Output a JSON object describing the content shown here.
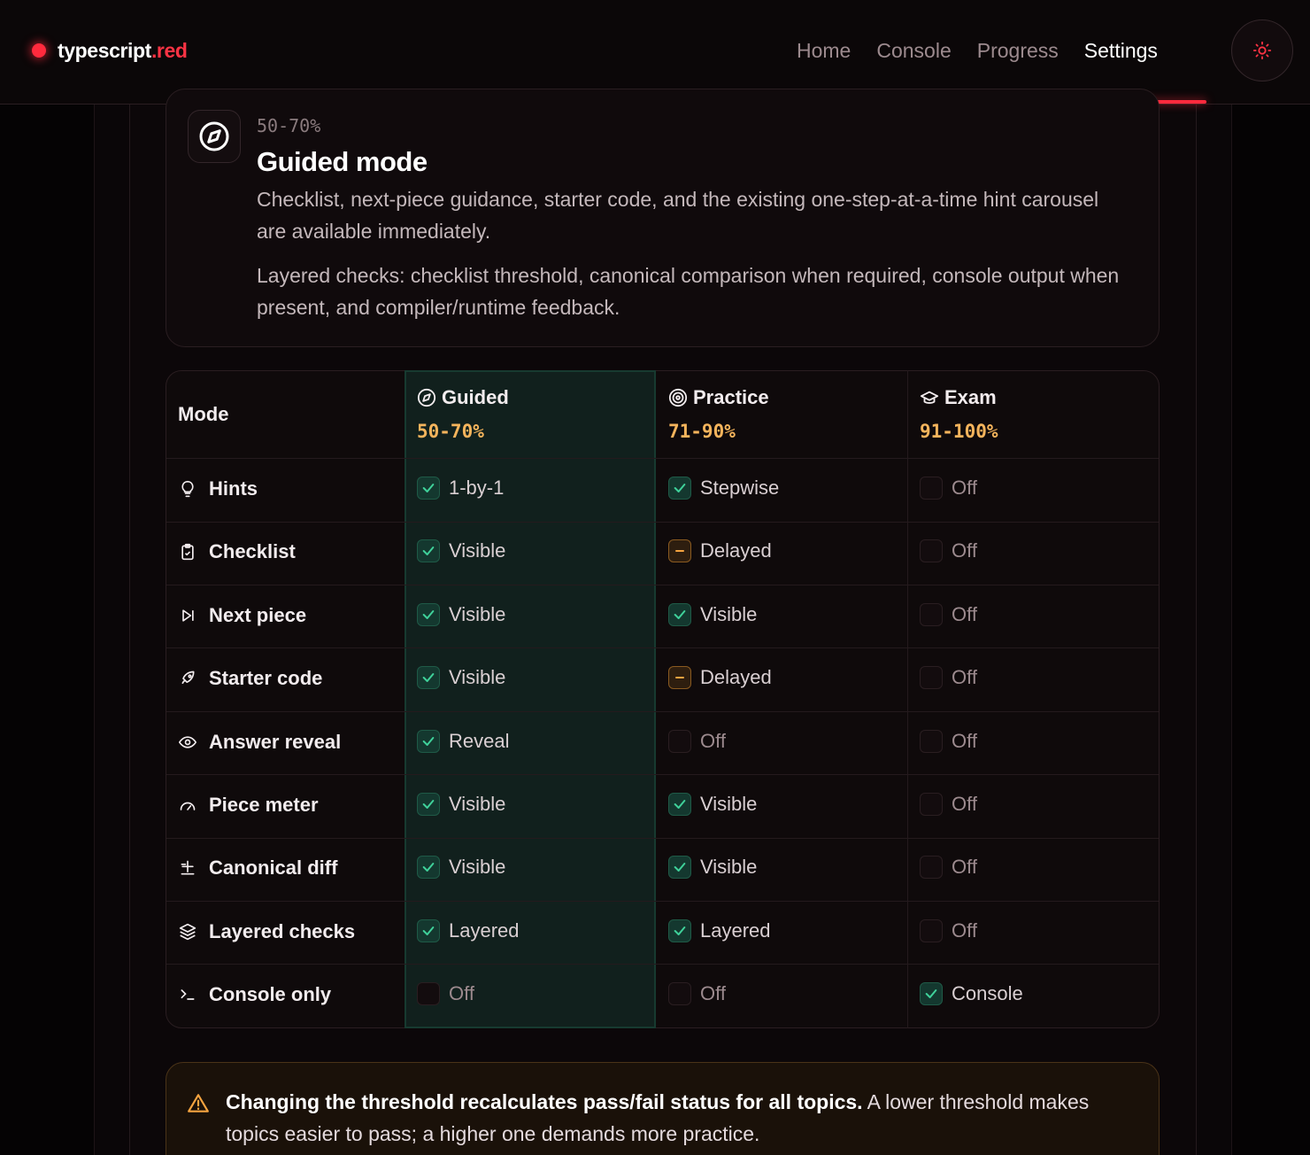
{
  "brand": {
    "name": "typescript",
    "tld": ".red"
  },
  "nav": {
    "items": [
      {
        "label": "Home",
        "active": false
      },
      {
        "label": "Console",
        "active": false
      },
      {
        "label": "Progress",
        "active": false
      },
      {
        "label": "Settings",
        "active": true
      }
    ],
    "theme_icon": "sun-icon"
  },
  "mode_card": {
    "icon": "compass-icon",
    "range": "50-70%",
    "title": "Guided mode",
    "description": "Checklist, next-piece guidance, starter code, and the existing one-step-at-a-time hint carousel are available immediately.",
    "checks_note": "Layered checks: checklist threshold, canonical comparison when required, console output when present, and compiler/runtime feedback."
  },
  "table": {
    "mode_header": "Mode",
    "columns": [
      {
        "name": "Guided",
        "range": "50-70%",
        "icon": "compass-icon"
      },
      {
        "name": "Practice",
        "range": "71-90%",
        "icon": "target-icon"
      },
      {
        "name": "Exam",
        "range": "91-100%",
        "icon": "graduation-cap-icon"
      }
    ],
    "rows": [
      {
        "label": "Hints",
        "icon": "lightbulb-icon",
        "cells": [
          {
            "state": "on",
            "text": "1-by-1"
          },
          {
            "state": "on",
            "text": "Stepwise"
          },
          {
            "state": "off",
            "text": "Off"
          }
        ]
      },
      {
        "label": "Checklist",
        "icon": "clipboard-check-icon",
        "cells": [
          {
            "state": "on",
            "text": "Visible"
          },
          {
            "state": "partial",
            "text": "Delayed"
          },
          {
            "state": "off",
            "text": "Off"
          }
        ]
      },
      {
        "label": "Next piece",
        "icon": "skip-forward-icon",
        "cells": [
          {
            "state": "on",
            "text": "Visible"
          },
          {
            "state": "on",
            "text": "Visible"
          },
          {
            "state": "off",
            "text": "Off"
          }
        ]
      },
      {
        "label": "Starter code",
        "icon": "rocket-icon",
        "cells": [
          {
            "state": "on",
            "text": "Visible"
          },
          {
            "state": "partial",
            "text": "Delayed"
          },
          {
            "state": "off",
            "text": "Off"
          }
        ]
      },
      {
        "label": "Answer reveal",
        "icon": "eye-icon",
        "cells": [
          {
            "state": "on",
            "text": "Reveal"
          },
          {
            "state": "off",
            "text": "Off"
          },
          {
            "state": "off",
            "text": "Off"
          }
        ]
      },
      {
        "label": "Piece meter",
        "icon": "gauge-icon",
        "cells": [
          {
            "state": "on",
            "text": "Visible"
          },
          {
            "state": "on",
            "text": "Visible"
          },
          {
            "state": "off",
            "text": "Off"
          }
        ]
      },
      {
        "label": "Canonical diff",
        "icon": "diff-icon",
        "cells": [
          {
            "state": "on",
            "text": "Visible"
          },
          {
            "state": "on",
            "text": "Visible"
          },
          {
            "state": "off",
            "text": "Off"
          }
        ]
      },
      {
        "label": "Layered checks",
        "icon": "layers-icon",
        "cells": [
          {
            "state": "on",
            "text": "Layered"
          },
          {
            "state": "on",
            "text": "Layered"
          },
          {
            "state": "off",
            "text": "Off"
          }
        ]
      },
      {
        "label": "Console only",
        "icon": "terminal-icon",
        "cells": [
          {
            "state": "off",
            "text": "Off"
          },
          {
            "state": "off",
            "text": "Off"
          },
          {
            "state": "on",
            "text": "Console"
          }
        ]
      }
    ]
  },
  "warning": {
    "icon": "warning-triangle-icon",
    "bold": "Changing the threshold recalculates pass/fail status for all topics.",
    "text": " A lower threshold makes topics easier to pass; a higher one demands more practice."
  },
  "colors": {
    "accent": "#ff2a3d",
    "range": "#f5b45c",
    "check": "#3fd19a",
    "partial": "#f5a440"
  }
}
